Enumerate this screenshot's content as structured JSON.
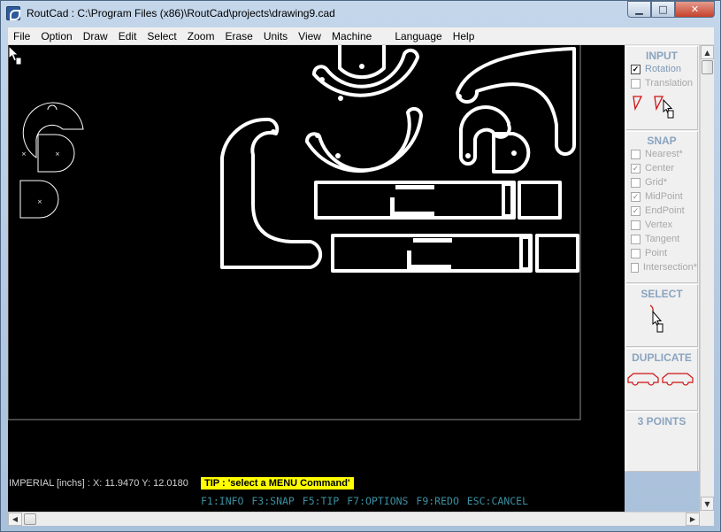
{
  "window": {
    "title": "RoutCad : C:\\Program Files (x86)\\RoutCad\\projects\\drawing9.cad",
    "buttons": {
      "minimize": "▁",
      "maximize": "□",
      "close": "✕"
    }
  },
  "menu": [
    "File",
    "Option",
    "Draw",
    "Edit",
    "Select",
    "Zoom",
    "Erase",
    "Units",
    "View",
    "Machine",
    "Language",
    "Help"
  ],
  "status": {
    "units_label": "IMPERIAL [inchs] :",
    "x_label": "X:",
    "x_value": "11.9470",
    "y_label": "Y:",
    "y_value": "12.0180",
    "tip": "TIP : 'select a MENU Command'",
    "fkeys": "F1:INFO  F3:SNAP  F5:TIP  F7:OPTIONS  F9:REDO  ESC:CANCEL"
  },
  "side": {
    "input": {
      "title": "INPUT",
      "rotation": "Rotation",
      "translation": "Translation"
    },
    "snap": {
      "title": "SNAP",
      "options": [
        {
          "label": "Nearest*",
          "checked": false
        },
        {
          "label": "Center",
          "checked": true
        },
        {
          "label": "Grid*",
          "checked": false
        },
        {
          "label": "MidPoint",
          "checked": true
        },
        {
          "label": "EndPoint",
          "checked": true
        },
        {
          "label": "Vertex",
          "checked": false
        },
        {
          "label": "Tangent",
          "checked": false
        },
        {
          "label": "Point",
          "checked": false
        },
        {
          "label": "Intersection*",
          "checked": false
        }
      ]
    },
    "select": {
      "title": "SELECT"
    },
    "duplicate": {
      "title": "DUPLICATE"
    },
    "three_points": {
      "title": "3 POINTS"
    }
  },
  "colors": {
    "panel_title": "#8aa4c0",
    "tip_bg": "#ffff00",
    "fkeys": "#3a8fa0",
    "icon_red": "#d01010",
    "drawing": "#ffffff",
    "canvas": "#000000"
  }
}
